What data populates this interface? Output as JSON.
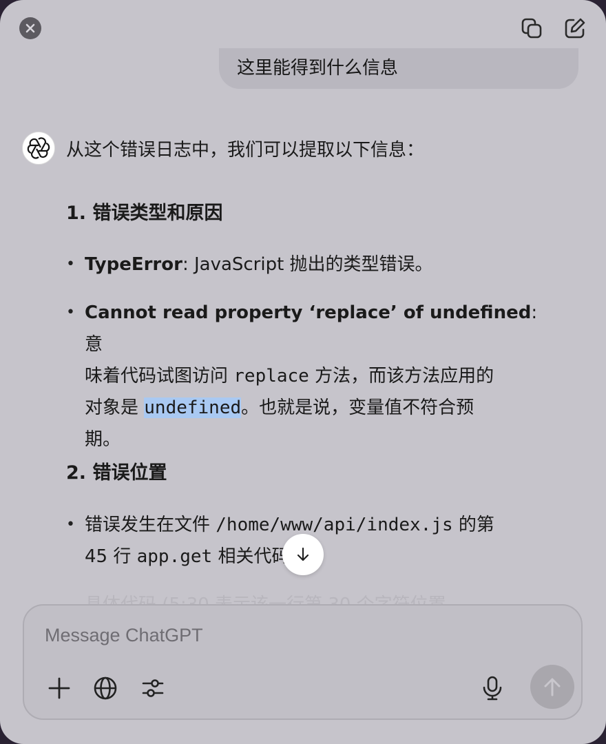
{
  "user_message": "这里能得到什么信息",
  "assistant": {
    "intro": "从这个错误日志中，我们可以提取以下信息：",
    "section1": {
      "heading": "1. 错误类型和原因",
      "item1": {
        "bold": "TypeError",
        "text": ": JavaScript 抛出的类型错误。"
      },
      "item2": {
        "bold": "Cannot read property ‘replace’ of undefined",
        "line1_tail": ": 意",
        "line2_pre": "味着代码试图访问 ",
        "code1": "replace",
        "line2_post": " 方法，而该方法应用的",
        "line3_pre": "对象是 ",
        "code2": "undefined",
        "line3_post": "。也就是说，变量值不符合预",
        "line4": "期。"
      }
    },
    "section2": {
      "heading": "2. 错误位置",
      "item1": {
        "pre": "错误发生在文件 ",
        "code1": "/home/www/api/index.js",
        "mid": " 的第",
        "line2_pre": "45 行 ",
        "code2": "app.get",
        "line2_post": " 相关代码。"
      },
      "faded_text": "具体代码 (5:30 表示该一行第 30 个字符位置"
    }
  },
  "composer": {
    "placeholder": "Message ChatGPT"
  },
  "icons": {
    "close": "close-icon",
    "copy": "copy-icon",
    "edit": "edit-icon",
    "scroll": "arrow-down-icon",
    "plus": "plus-icon",
    "globe": "globe-icon",
    "tools": "sliders-icon",
    "mic": "microphone-icon",
    "send": "arrow-up-icon"
  },
  "colors": {
    "window_bg": "#c6c4cb",
    "highlight": "#a9c9f2",
    "send_disabled": "#a9a7ad"
  }
}
